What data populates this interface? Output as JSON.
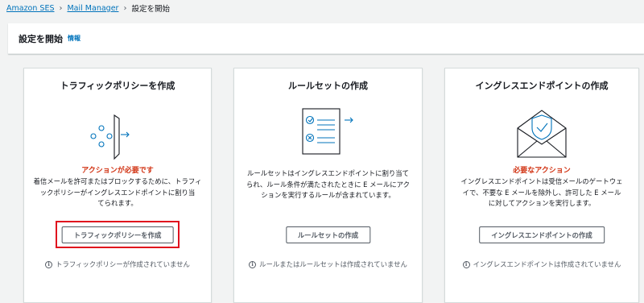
{
  "breadcrumb": {
    "items": [
      "Amazon SES",
      "Mail Manager"
    ],
    "current": "設定を開始"
  },
  "header": {
    "title": "設定を開始",
    "info_link": "情報"
  },
  "cards": [
    {
      "title": "トラフィックポリシーを作成",
      "status": "アクションが必要です",
      "description_lines": [
        "着信メールを許可またはブロックするために、トラフィ",
        "ックポリシーがイングレスエンドポイントに割り当",
        "てられます。"
      ],
      "button": "トラフィックポリシーを作成",
      "note": "トラフィックポリシーが作成されていません",
      "icon": "traffic-policy-icon"
    },
    {
      "title": "ルールセットの作成",
      "status": "",
      "description_lines": [
        "ルールセットはイングレスエンドポイントに割り当て",
        "られ、ルール条件が満たされたときに E メールにアク",
        "ションを実行するルールが含まれています。"
      ],
      "button": "ルールセットの作成",
      "note": "ルールまたはルールセットは作成されていません",
      "icon": "rule-set-icon"
    },
    {
      "title": "イングレスエンドポイントの作成",
      "status": "必要なアクション",
      "description_lines": [
        "イングレスエンドポイントは受信メールのゲートウェ",
        "イで、不要な E メールを除外し、許可した E メール",
        "に対してアクションを実行します。"
      ],
      "button": "イングレスエンドポイントの作成",
      "note": "イングレスエンドポイントは作成されていません",
      "icon": "ingress-endpoint-icon"
    }
  ],
  "colors": {
    "link": "#0073bb",
    "warning": "#d13212",
    "highlight": "#e0101e",
    "illustration": "#0073bb"
  }
}
